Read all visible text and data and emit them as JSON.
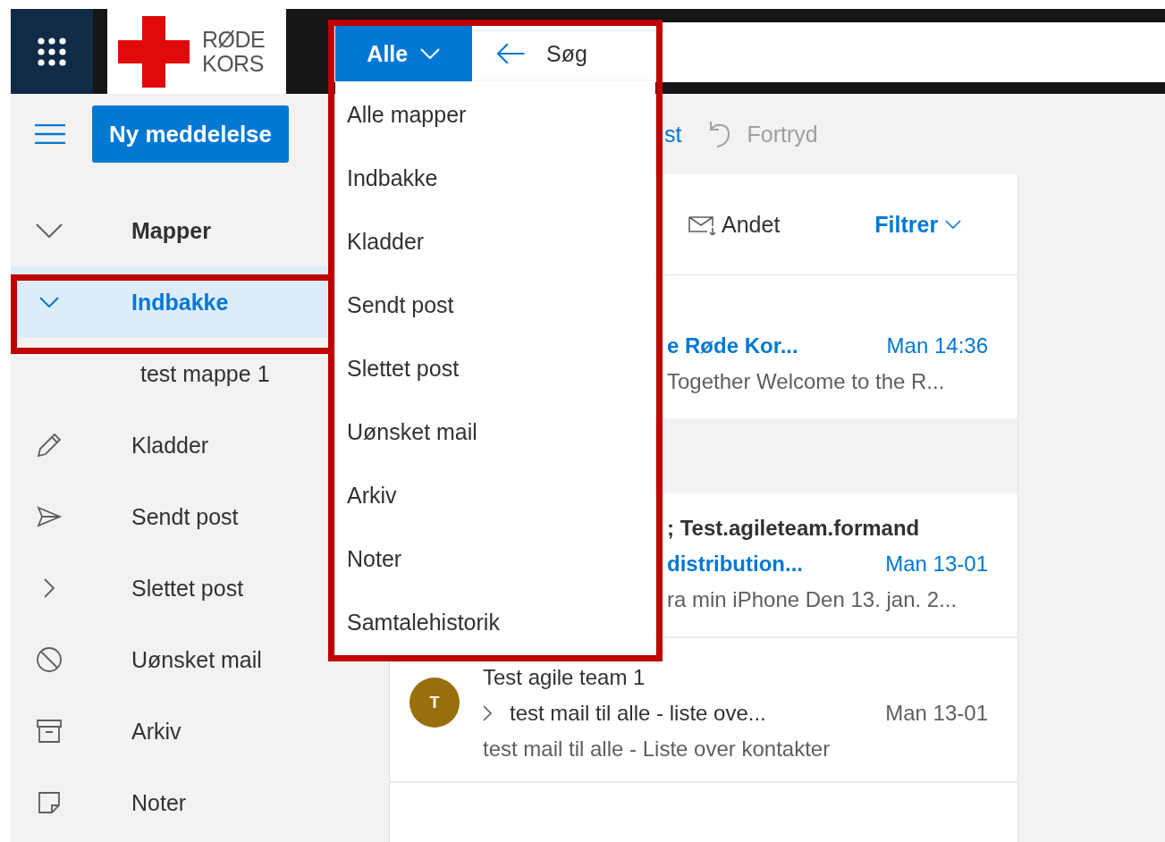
{
  "logo": {
    "lines": [
      "RØDE",
      "KORS"
    ]
  },
  "search": {
    "scope": "Alle",
    "placeholder": "Søg"
  },
  "scope_menu": {
    "items": [
      {
        "label": "Alle mapper"
      },
      {
        "label": "Indbakke"
      },
      {
        "label": "Kladder"
      },
      {
        "label": "Sendt post"
      },
      {
        "label": "Slettet post"
      },
      {
        "label": "Uønsket mail"
      },
      {
        "label": "Arkiv"
      },
      {
        "label": "Noter"
      },
      {
        "label": "Samtalehistorik"
      }
    ]
  },
  "command_bar": {
    "new_button": "Ny meddelelse",
    "partial_action": "st",
    "undo": "Fortryd"
  },
  "sidebar": {
    "header": "Mapper",
    "items": [
      {
        "label": "Indbakke",
        "expanded": true,
        "selected": true,
        "children": [
          {
            "label": "test mappe 1",
            "selected": false
          }
        ]
      },
      {
        "label": "Kladder",
        "selected": false
      },
      {
        "label": "Sendt post",
        "selected": false
      },
      {
        "label": "Slettet post",
        "expanded": false,
        "selected": false
      },
      {
        "label": "Uønsket mail",
        "selected": false
      },
      {
        "label": "Arkiv",
        "selected": false
      },
      {
        "label": "Noter",
        "selected": false
      }
    ]
  },
  "message_list": {
    "other_tab": "Andet",
    "filter": "Filtrer",
    "rows": [
      {
        "kind": "covered",
        "subject": "e Røde Kor...",
        "time": "Man 14:36",
        "unread": true,
        "preview": "Together Welcome to the R..."
      },
      {
        "kind": "covered",
        "sender": "; Test.agileteam.formand",
        "subject": "distribution...",
        "time": "Man 13-01",
        "unread": true,
        "preview": "ra min iPhone Den 13. jan. 2..."
      },
      {
        "kind": "full",
        "avatar": "T",
        "sender": "Test agile team 1",
        "subject": "test mail til alle - liste ove...",
        "time": "Man 13-01",
        "unread": false,
        "preview": "test mail til alle - Liste over kontakter"
      }
    ]
  }
}
